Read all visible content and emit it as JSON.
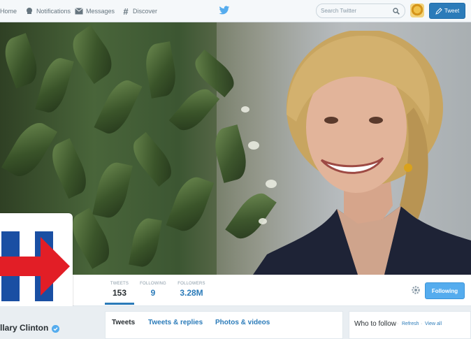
{
  "nav": {
    "home_label": "Home",
    "notifications_label": "Notifications",
    "messages_label": "Messages",
    "discover_label": "Discover",
    "search_placeholder": "Search Twitter",
    "tweet_button_label": "Tweet"
  },
  "profile": {
    "name": "llary Clinton",
    "stats": [
      {
        "label": "TWEETS",
        "value": "153"
      },
      {
        "label": "FOLLOWING",
        "value": "9"
      },
      {
        "label": "FOLLOWERS",
        "value": "3.28M"
      }
    ],
    "following_button_label": "Following"
  },
  "tabs": [
    {
      "label": "Tweets"
    },
    {
      "label": "Tweets & replies"
    },
    {
      "label": "Photos & videos"
    }
  ],
  "who_to_follow": {
    "title": "Who to follow",
    "sep": "·",
    "refresh_label": "Refresh",
    "view_all_label": "View all"
  },
  "colors": {
    "accent": "#2b7bb9",
    "following_button": "#55acee",
    "logo_blue": "#1a4fa3",
    "logo_red": "#e21e26"
  },
  "icons": [
    "home-icon",
    "notifications-icon",
    "messages-icon",
    "discover-icon",
    "twitter-bird-icon",
    "search-icon",
    "gear-icon",
    "verified-icon",
    "compose-tweet-icon"
  ]
}
